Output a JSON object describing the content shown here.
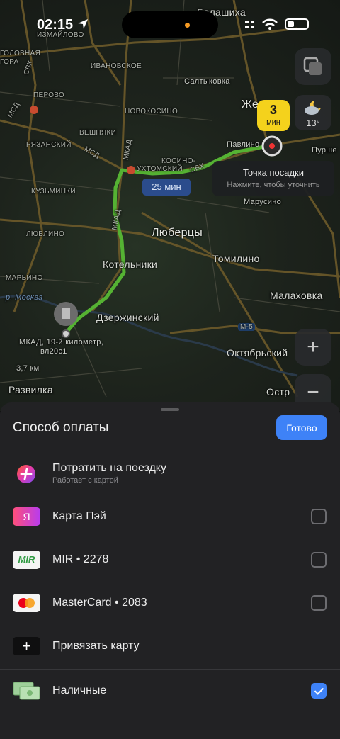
{
  "status_bar": {
    "time": "02:15"
  },
  "map": {
    "labels": {
      "balashikha": "Балашиха",
      "izmaylovo": "ИЗМАЙЛОВО",
      "golovnaya": "ГОЛОВНАЯ",
      "gora": "ГОРА",
      "ivanovskoe": "ИВАНОВСКОЕ",
      "saltykovka": "Салтыковка",
      "perovo": "ПЕРОВО",
      "novokosino": "НОВОКОСИНО",
      "veshnyaki": "ВЕШНЯКИ",
      "ryazansky": "РЯЗАНСКИЙ",
      "kosino": "КОСИНО-",
      "ukhtomsky": "УХТОМСКИЙ",
      "zhel": "Жел",
      "pavlino": "Павлино",
      "purshe": "Пурше",
      "kuzminki": "КУЗЬМИНКИ",
      "marusino": "Марусино",
      "lyublino": "ЛЮБЛИНО",
      "lyubertsy": "Люберцы",
      "kotelniki": "Котельники",
      "tomilino": "Томилино",
      "maryino": "МАРЬИНО",
      "moskva_river": "р. Москва",
      "malakhovka": "Малаховка",
      "dzerzhinsky": "Дзержинский",
      "m5": "М-5",
      "mkad_point_1": "МКАД, 19-й километр,",
      "mkad_point_2": "вл20с1",
      "oktyabrsky": "Октябрьский",
      "scale": "3,7 км",
      "razvilka": "Развилка",
      "ostr": "Остр",
      "mkad": "МКАД",
      "mcd": "МСД",
      "svkh": "СВХ"
    },
    "eta": {
      "value": "3",
      "unit": "мин"
    },
    "weather": {
      "temp": "13°"
    },
    "pickup": {
      "title": "Точка посадки",
      "hint": "Нажмите, чтобы уточнить"
    },
    "route_time": "25 мин",
    "zoom_in": "+",
    "zoom_out": "−"
  },
  "sheet": {
    "title": "Способ оплаты",
    "done_label": "Готово",
    "methods": [
      {
        "name": "Потратить на поездку",
        "sub": "Работает с картой",
        "icon": "plus-points-icon",
        "checkbox": false
      },
      {
        "name": "Карта Пэй",
        "icon": "yandex-pay-card-icon",
        "checked": false
      },
      {
        "name": "MIR • 2278",
        "icon": "mir-card-icon",
        "checked": false
      },
      {
        "name": "MasterCard • 2083",
        "icon": "mastercard-icon",
        "checked": false
      },
      {
        "name": "Привязать карту",
        "icon": "add-card-icon",
        "checkbox": false
      },
      {
        "name": "Наличные",
        "icon": "cash-icon",
        "checked": true
      }
    ],
    "icon_texts": {
      "yandex": "Я",
      "mir": "MIR"
    },
    "colors": {
      "accent": "#3e82f7",
      "eta_badge": "#f4d21c",
      "route": "#55b233"
    }
  }
}
